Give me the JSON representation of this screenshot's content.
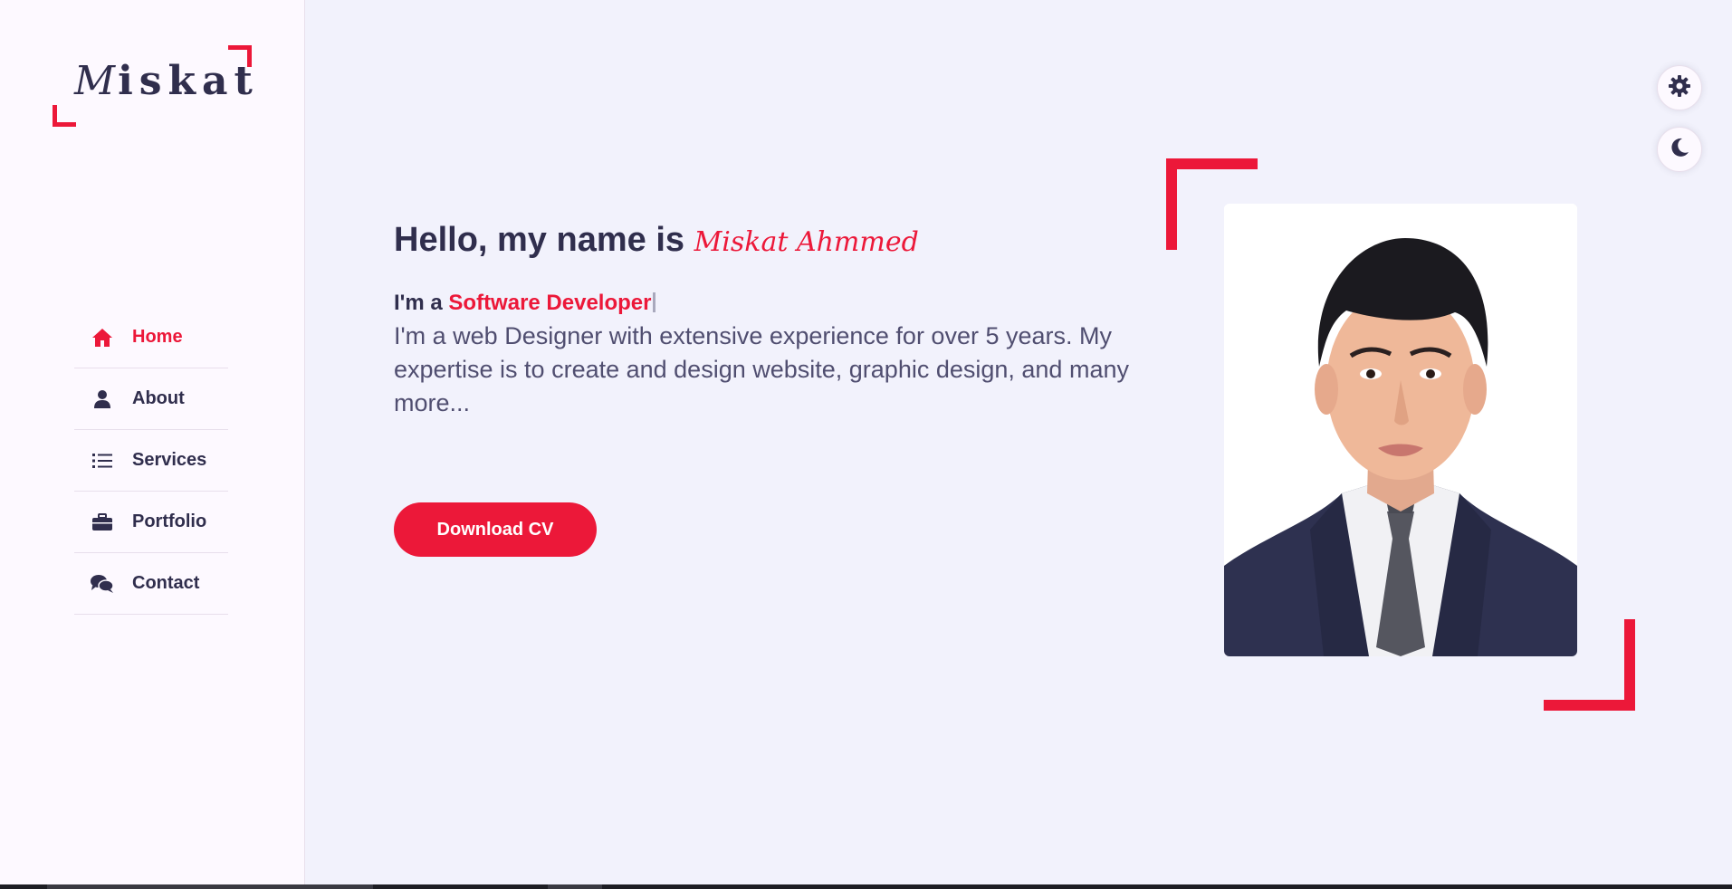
{
  "colors": {
    "accent": "#ec1839",
    "text": "#302e4d",
    "bg": "#f2f2fc",
    "sidebar": "#fdf9ff"
  },
  "logo": {
    "first": "M",
    "rest": "iskat"
  },
  "nav": [
    {
      "label": "Home",
      "icon": "home-icon",
      "active": true
    },
    {
      "label": "About",
      "icon": "user-icon"
    },
    {
      "label": "Services",
      "icon": "list-icon"
    },
    {
      "label": "Portfolio",
      "icon": "briefcase-icon"
    },
    {
      "label": "Contact",
      "icon": "comments-icon"
    }
  ],
  "hero": {
    "greeting": "Hello, my name is",
    "name": "Miskat Ahmmed",
    "role_prefix": "I'm a",
    "role": "Software Developer",
    "description": "I'm a web Designer with extensive experience for over 5 years. My expertise is to create and design website, graphic design, and many more...",
    "cta": "Download CV"
  },
  "style_switcher": {
    "settings_icon": "gear-icon",
    "theme_icon": "moon-icon"
  }
}
